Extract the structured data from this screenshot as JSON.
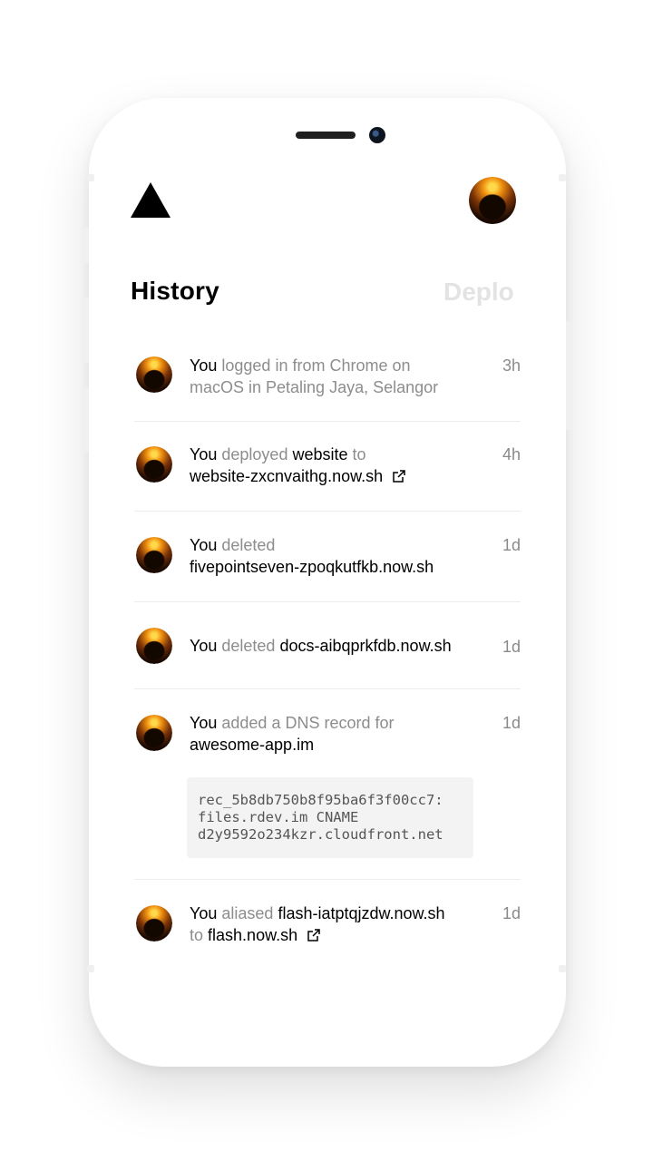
{
  "header": {
    "logo_icon": "triangle-logo-icon",
    "avatar_icon": "user-avatar"
  },
  "tabs": [
    {
      "label": "History",
      "active": true
    },
    {
      "label": "Deplo",
      "active": false
    }
  ],
  "feed": [
    {
      "actor": "You",
      "line1_rest": "logged in from Chrome on",
      "line2": "macOS in Petaling Jaya, Selangor",
      "time": "3h"
    },
    {
      "actor": "You",
      "action": "deployed",
      "target": "website",
      "connector": "to",
      "link": "website-zxcnvaithg.now.sh",
      "external_icon": "external-link-icon",
      "time": "4h"
    },
    {
      "actor": "You",
      "action": "deleted",
      "target": "fivepointseven-zpoqkutfkb.now.sh",
      "time": "1d"
    },
    {
      "actor": "You",
      "action": "deleted",
      "target": "docs-aibqprkfdb.now.sh",
      "time": "1d"
    },
    {
      "actor": "You",
      "action": "added a DNS record for",
      "target": "awesome-app.im",
      "time": "1d",
      "code": "rec_5b8db750b8f95ba6f3f00cc7:\nfiles.rdev.im CNAME\nd2y9592o234kzr.cloudfront.net"
    },
    {
      "actor": "You",
      "action": "aliased",
      "target": "flash-iatptqjzdw.now.sh",
      "connector": "to",
      "link": "flash.now.sh",
      "external_icon": "external-link-icon",
      "time": "1d"
    }
  ],
  "colors": {
    "primary_text": "#000000",
    "muted_text": "#8d8d8d",
    "inactive_tab": "#e3e3e3",
    "divider": "#ececec",
    "code_bg": "#f3f3f3"
  }
}
